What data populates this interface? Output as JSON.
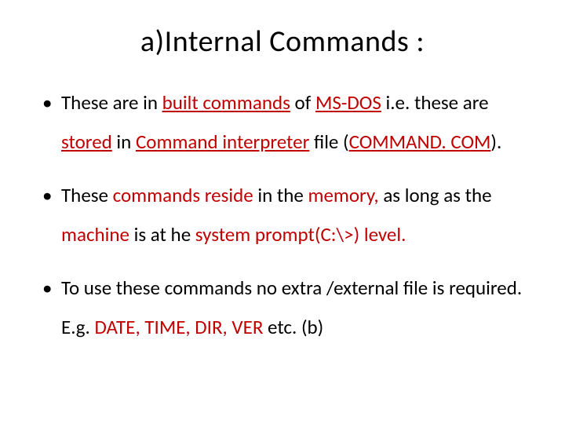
{
  "title": "a)Internal Commands :",
  "b1": {
    "t1": "These are in ",
    "t2": "built commands",
    "t3": " of ",
    "t4": "MS-DOS",
    "t5": " i.e. these are ",
    "t6": "stored",
    "t7": " in ",
    "t8": "Command interpreter",
    "t9": " file (",
    "t10": "COMMAND. COM",
    "t11": ")."
  },
  "b2": {
    "t1": "These ",
    "t2": "commands reside",
    "t3": " in the ",
    "t4": "memory,",
    "t5": " as long as the ",
    "t6": "machine",
    "t7": " is at he ",
    "t8": "system prompt(",
    "t9": "C:\\>",
    "t10": ") ",
    "t11": "level."
  },
  "b3": {
    "t1": " To use these commands no extra /external file is required. E.g. ",
    "t2": "DATE, TIME, DIR, VER",
    "t3": " etc. (b)"
  }
}
